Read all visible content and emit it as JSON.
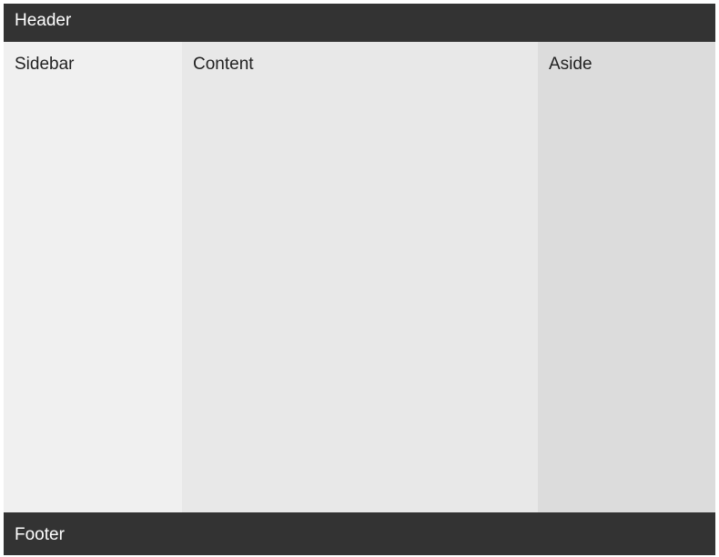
{
  "header": {
    "label": "Header"
  },
  "sidebar": {
    "label": "Sidebar"
  },
  "content": {
    "label": "Content"
  },
  "aside": {
    "label": "Aside"
  },
  "footer": {
    "label": "Footer"
  },
  "colors": {
    "header_bg": "#333333",
    "sidebar_bg": "#f0f0f0",
    "content_bg": "#e8e8e8",
    "aside_bg": "#dcdcdc",
    "footer_bg": "#333333",
    "dark_text": "#222222",
    "light_text": "#ffffff"
  }
}
